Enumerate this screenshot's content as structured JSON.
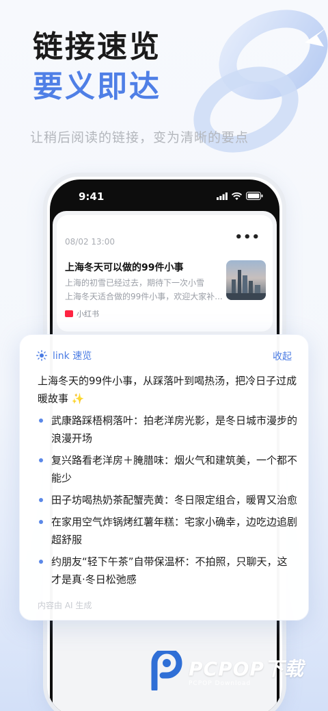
{
  "headline": {
    "line1": "链接速览",
    "line2": "要义即达"
  },
  "subtitle": "让稍后阅读的链接，变为清晰的要点",
  "colors": {
    "accent": "#4a7be3",
    "brand": "#ff2442"
  },
  "phone": {
    "status_time": "9:41",
    "feed_card": {
      "date": "08/02 13:00",
      "more": "•••",
      "title": "上海冬天可以做的99件小事",
      "desc_line1": "上海的初雪已经过去，期待下一次小雪",
      "desc_line2": "上海冬天适合做的99件小事，欢迎大家补...",
      "source": "小红书",
      "thumbnail": "city-skyline-image"
    }
  },
  "summary": {
    "title": "link 速览",
    "collapse": "收起",
    "intro": "上海冬天的99件小事，从踩落叶到喝热汤，把冷日子过成暖故事 ✨",
    "items": [
      "武康路踩梧桐落叶：拍老洋房光影，是冬日城市漫步的浪漫开场",
      "复兴路看老洋房＋腌腊味：烟火气和建筑美，一个都不能少",
      "田子坊喝热奶茶配蟹壳黄：冬日限定组合，暖胃又治愈",
      "在家用空气炸锅烤红薯年糕：宅家小确幸，边吃边追剧超舒服",
      "约朋友“轻下午茶”自带保温杯：不拍照，只聊天，这才是真·冬日松弛感"
    ],
    "footer": "内容由 AI 生成"
  },
  "watermark": {
    "brand": "PCPOP下载",
    "sub": "PCPOP Download"
  }
}
